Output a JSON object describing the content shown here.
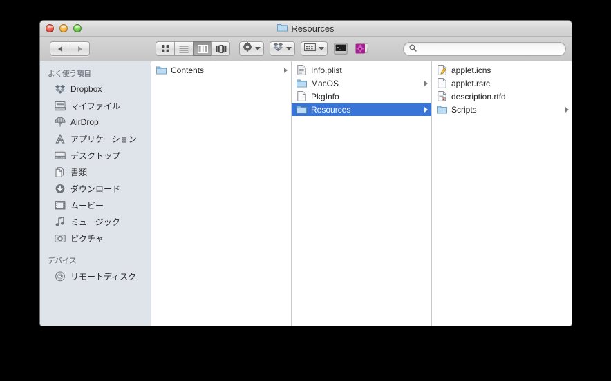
{
  "window": {
    "title": "Resources",
    "title_icon": "folder-icon",
    "traffic_lights": [
      {
        "name": "close-button",
        "color": "#e24b3c"
      },
      {
        "name": "minimize-button",
        "color": "#f0a92c"
      },
      {
        "name": "zoom-button",
        "color": "#5ec242"
      }
    ]
  },
  "toolbar": {
    "back_label": "",
    "forward_label": "",
    "view_modes": [
      {
        "name": "icon-view",
        "selected": false
      },
      {
        "name": "list-view",
        "selected": false
      },
      {
        "name": "column-view",
        "selected": true
      },
      {
        "name": "coverflow-view",
        "selected": false
      }
    ],
    "action_menu": "gear-icon",
    "dropbox_menu": "dropbox-icon",
    "arrange_menu": "arrange-icon",
    "terminal_item": "terminal-icon",
    "app_item": "purple-app-icon",
    "search": {
      "value": "",
      "placeholder": ""
    }
  },
  "sidebar": {
    "sections": [
      {
        "header": "よく使う項目",
        "items": [
          {
            "label": "Dropbox",
            "icon": "dropbox-icon"
          },
          {
            "label": "マイファイル",
            "icon": "all-my-files-icon"
          },
          {
            "label": "AirDrop",
            "icon": "airdrop-icon"
          },
          {
            "label": "アプリケーション",
            "icon": "applications-icon"
          },
          {
            "label": "デスクトップ",
            "icon": "desktop-icon"
          },
          {
            "label": "書類",
            "icon": "documents-icon"
          },
          {
            "label": "ダウンロード",
            "icon": "downloads-icon"
          },
          {
            "label": "ムービー",
            "icon": "movies-icon"
          },
          {
            "label": "ミュージック",
            "icon": "music-icon"
          },
          {
            "label": "ピクチャ",
            "icon": "pictures-icon"
          }
        ]
      },
      {
        "header": "デバイス",
        "items": [
          {
            "label": "リモートディスク",
            "icon": "remote-disc-icon"
          }
        ]
      }
    ]
  },
  "columns": [
    {
      "name": "column-1",
      "rows": [
        {
          "label": "Contents",
          "icon": "folder-icon",
          "has_disclosure": true,
          "selected": false
        }
      ]
    },
    {
      "name": "column-2",
      "rows": [
        {
          "label": "Info.plist",
          "icon": "plist-document-icon",
          "has_disclosure": false,
          "selected": false
        },
        {
          "label": "MacOS",
          "icon": "folder-icon",
          "has_disclosure": true,
          "selected": false
        },
        {
          "label": "PkgInfo",
          "icon": "blank-document-icon",
          "has_disclosure": false,
          "selected": false
        },
        {
          "label": "Resources",
          "icon": "folder-icon",
          "has_disclosure": true,
          "selected": true
        }
      ]
    },
    {
      "name": "column-3",
      "rows": [
        {
          "label": "applet.icns",
          "icon": "icns-document-icon",
          "has_disclosure": false,
          "selected": false
        },
        {
          "label": "applet.rsrc",
          "icon": "blank-document-icon",
          "has_disclosure": false,
          "selected": false
        },
        {
          "label": "description.rtfd",
          "icon": "rtfd-document-icon",
          "has_disclosure": false,
          "selected": false
        },
        {
          "label": "Scripts",
          "icon": "folder-icon",
          "has_disclosure": true,
          "selected": false
        }
      ]
    }
  ],
  "colors": {
    "selection": "#3875d7",
    "sidebar_bg": "#dfe3ea",
    "folder_blue": "#9fc9e8",
    "desktop_bg": "#000000"
  }
}
